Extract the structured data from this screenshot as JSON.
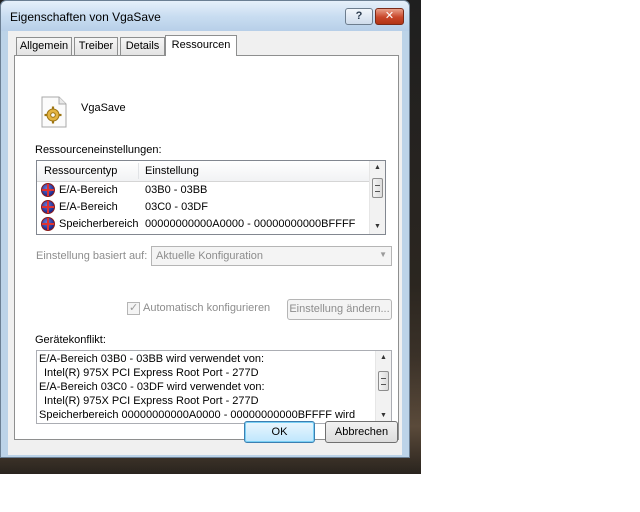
{
  "window": {
    "title": "Eigenschaften von VgaSave",
    "help_symbol": "?",
    "close_symbol": "✕"
  },
  "tabs": [
    {
      "label": "Allgemein",
      "active": false
    },
    {
      "label": "Treiber",
      "active": false
    },
    {
      "label": "Details",
      "active": false
    },
    {
      "label": "Ressourcen",
      "active": true
    }
  ],
  "device": {
    "name": "VgaSave",
    "icon": "gear-document-icon"
  },
  "resources": {
    "section_label": "Ressourceneinstellungen:",
    "columns": [
      "Ressourcentyp",
      "Einstellung"
    ],
    "rows": [
      {
        "type": "E/A-Bereich",
        "setting": "03B0 - 03BB",
        "icon": "resource-conflict-icon"
      },
      {
        "type": "E/A-Bereich",
        "setting": "03C0 - 03DF",
        "icon": "resource-conflict-icon"
      },
      {
        "type": "Speicherbereich",
        "setting": "00000000000A0000 - 00000000000BFFFF",
        "icon": "resource-conflict-icon"
      }
    ]
  },
  "based_on": {
    "label": "Einstellung basiert auf:",
    "value": "Aktuelle Konfiguration",
    "enabled": false
  },
  "auto_config": {
    "label": "Automatisch konfigurieren",
    "checked": true,
    "enabled": false
  },
  "change_button": "Einstellung ändern...",
  "conflict": {
    "label": "Gerätekonflikt:",
    "lines": [
      "E/A-Bereich 03B0 - 03BB wird verwendet von:",
      "Intel(R) 975X PCI Express Root Port - 277D",
      "E/A-Bereich 03C0 - 03DF wird verwendet von:",
      "Intel(R) 975X PCI Express Root Port - 277D",
      "Speicherbereich 00000000000A0000 - 00000000000BFFFF wird"
    ]
  },
  "buttons": {
    "ok": "OK",
    "cancel": "Abbrechen"
  },
  "colors": {
    "titlebar": "#c9ddf1",
    "close": "#c8462a",
    "default_button_border": "#3c7fb1"
  }
}
